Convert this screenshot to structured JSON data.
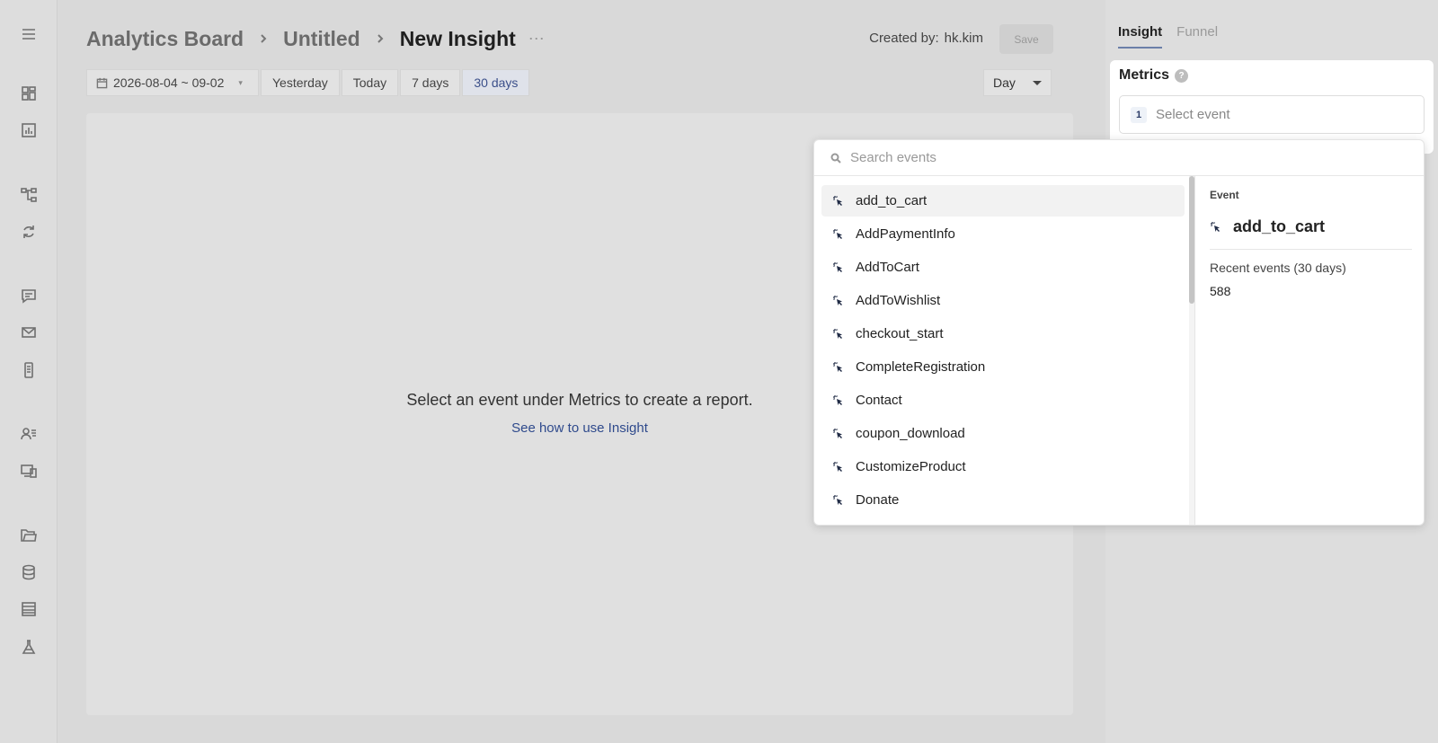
{
  "breadcrumb": {
    "items": [
      "Analytics Board",
      "Untitled"
    ],
    "current": "New Insight"
  },
  "header": {
    "created_by_label": "Created by:",
    "created_by_user": "hk.kim",
    "save_label": "Save"
  },
  "date_bar": {
    "range": "2026-08-04 ~ 09-02",
    "quick_ranges": [
      "Yesterday",
      "Today",
      "7 days",
      "30 days"
    ],
    "active_range": "30 days",
    "granularity": "Day"
  },
  "empty_state": {
    "message": "Select an event under Metrics to create a report.",
    "link": "See how to use Insight"
  },
  "right_panel": {
    "tabs": [
      "Insight",
      "Funnel"
    ],
    "active_tab": "Insight",
    "metrics_label": "Metrics",
    "help_glyph": "?",
    "metric_index": "1",
    "select_placeholder": "Select event"
  },
  "event_dropdown": {
    "search_placeholder": "Search events",
    "events": [
      "add_to_cart",
      "AddPaymentInfo",
      "AddToCart",
      "AddToWishlist",
      "checkout_start",
      "CompleteRegistration",
      "Contact",
      "coupon_download",
      "CustomizeProduct",
      "Donate"
    ],
    "highlighted": "add_to_cart",
    "detail": {
      "section_label": "Event",
      "name": "add_to_cart",
      "recent_label": "Recent events (30 days)",
      "recent_count": "588"
    }
  },
  "icons": {
    "sidebar": [
      "menu-icon",
      "dashboard-icon",
      "chart-icon",
      "flow-icon",
      "refresh-icon",
      "message-icon",
      "mail-icon",
      "mobile-icon",
      "users-icon",
      "devices-icon",
      "folder-icon",
      "database-icon",
      "table-icon",
      "flask-icon"
    ],
    "event": "click-pointer-icon"
  },
  "colors": {
    "accent": "#3b4f8a",
    "link": "#2f4a8c",
    "event_icon": "#1f2a44"
  }
}
